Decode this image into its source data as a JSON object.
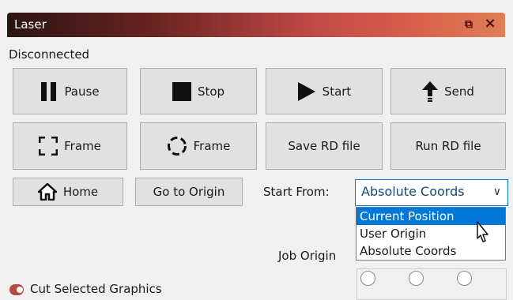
{
  "window": {
    "title": "Laser",
    "status": "Disconnected"
  },
  "buttons": {
    "pause": "Pause",
    "stop": "Stop",
    "start": "Start",
    "send": "Send",
    "frame_rect": "Frame",
    "frame_circle": "Frame",
    "save_rd": "Save RD file",
    "run_rd": "Run RD file",
    "home": "Home",
    "go_origin": "Go to Origin"
  },
  "start_from": {
    "label": "Start From:",
    "selected": "Absolute Coords",
    "options": [
      "Current Position",
      "User Origin",
      "Absolute Coords"
    ],
    "highlighted": "Current Position"
  },
  "job_origin_label": "Job Origin",
  "cut_selected_label": "Cut Selected Graphics",
  "colors": {
    "accent": "#0078d7",
    "title_start": "#2b1414",
    "title_end": "#e07e56",
    "toggle": "#b34b40"
  }
}
